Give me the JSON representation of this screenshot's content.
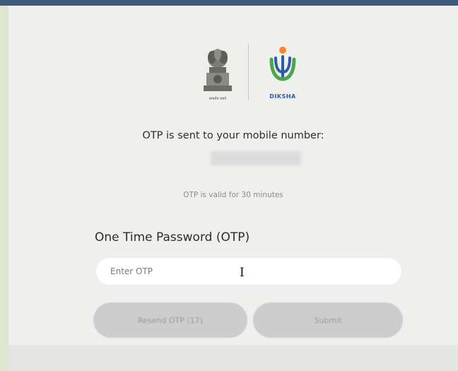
{
  "otp_page": {
    "logos": {
      "emblem_caption": "सत्यमेव जयते",
      "diksha_name": "DIKSHA"
    },
    "sent_message": "OTP is sent to your mobile number:",
    "validity_message": "OTP is valid for 30 minutes",
    "otp_label": "One Time Password (OTP)",
    "otp_input": {
      "placeholder": "Enter OTP",
      "value": ""
    },
    "resend_button_label": "Resend OTP (17)",
    "submit_button_label": "Submit"
  },
  "colors": {
    "top_bar": "#3d5a7a",
    "background": "#efefed",
    "frame": "#dfe6cf",
    "button_disabled": "#cdcdcd",
    "diksha_blue": "#2a5caa"
  },
  "icons": [
    "national-emblem-icon",
    "diksha-logo-icon",
    "text-cursor-icon"
  ]
}
